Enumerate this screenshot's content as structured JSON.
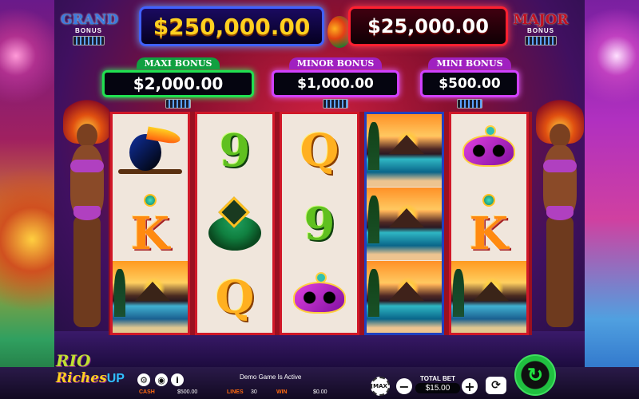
{
  "jackpots": {
    "grand": {
      "label_line1": "GRAND",
      "label_line2": "BONUS",
      "amount": "$250,000.00"
    },
    "major": {
      "label_line1": "MAJOR",
      "label_line2": "BONUS",
      "amount": "$25,000.00"
    },
    "maxi": {
      "label": "MAXI BONUS",
      "amount": "$2,000.00"
    },
    "minor": {
      "label": "MINOR BONUS",
      "amount": "$1,000.00"
    },
    "mini": {
      "label": "MINI BONUS",
      "amount": "$500.00"
    }
  },
  "reels": [
    {
      "symbols": [
        "toucan",
        "K",
        "sunset-island"
      ]
    },
    {
      "symbols": [
        "9",
        "feather-drum",
        "Q"
      ]
    },
    {
      "symbols": [
        "Q",
        "9",
        "carnival-mask"
      ]
    },
    {
      "symbols": [
        "sunset-island",
        "sunset-island",
        "sunset-island"
      ]
    },
    {
      "symbols": [
        "carnival-mask",
        "K",
        "sunset-island"
      ]
    }
  ],
  "symbol_text": {
    "K": "K",
    "Q": "Q",
    "9": "9"
  },
  "logo": {
    "line1": "RIO",
    "line2": "Riches",
    "line3": "UP"
  },
  "bottom": {
    "status": "Demo Game Is Active",
    "cash_label": "CASH",
    "cash_value": "$500.00",
    "lines_label": "LINES",
    "lines_value": "30",
    "win_label": "WIN",
    "win_value": "$0.00",
    "total_bet_label": "TOTAL BET",
    "total_bet_value": "$15.00",
    "max_label": "MAX",
    "info_label": "i",
    "minus_label": "−",
    "plus_label": "+"
  },
  "icons": [
    "settings-gear-icon",
    "sound-icon",
    "info-icon",
    "max-bet-chip-icon",
    "autoplay-icon",
    "spin-icon"
  ],
  "colors": {
    "grand_border": "#4060ff",
    "major_border": "#ff2030",
    "maxi_border": "#20e050",
    "minor_border": "#d040ff",
    "spin_green": "#20c040"
  }
}
